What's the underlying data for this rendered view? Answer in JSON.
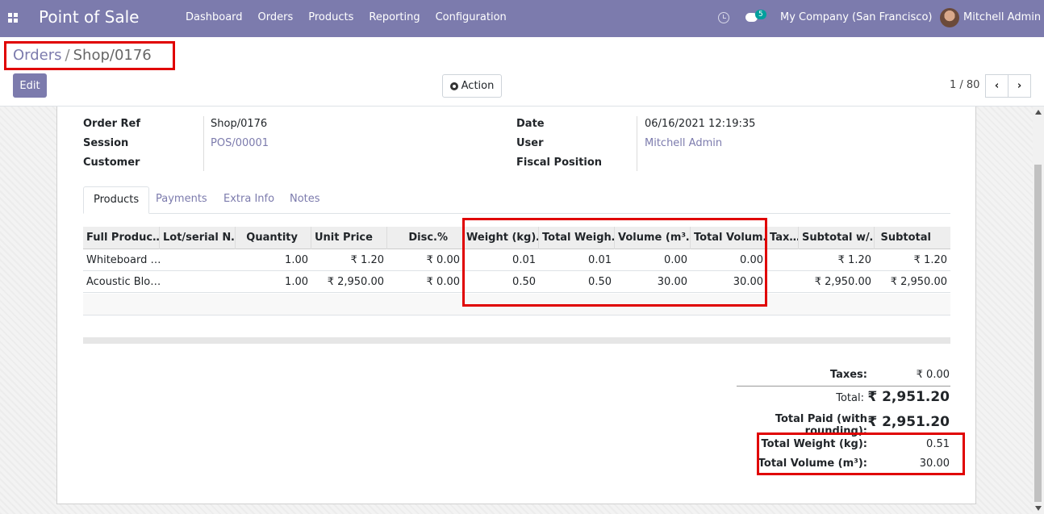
{
  "navbar": {
    "app_title": "Point of Sale",
    "menu": [
      "Dashboard",
      "Orders",
      "Products",
      "Reporting",
      "Configuration"
    ],
    "chat_count": "5",
    "company": "My Company (San Francisco)",
    "user": "Mitchell Admin",
    "accent": "#7c7bad"
  },
  "breadcrumb": {
    "parent": "Orders",
    "separator": "/",
    "current": "Shop/0176"
  },
  "toolbar": {
    "edit_label": "Edit",
    "action_label": "Action"
  },
  "pager": {
    "value": "1 / 80",
    "prev": "‹",
    "next": "›"
  },
  "form": {
    "order_ref_label": "Order Ref",
    "order_ref": "Shop/0176",
    "session_label": "Session",
    "session": "POS/00001",
    "customer_label": "Customer",
    "customer": "",
    "date_label": "Date",
    "date": "06/16/2021 12:19:35",
    "user_label": "User",
    "user": "Mitchell Admin",
    "fiscal_label": "Fiscal Position",
    "fiscal": ""
  },
  "tabs": [
    "Products",
    "Payments",
    "Extra Info",
    "Notes"
  ],
  "table": {
    "headers": [
      "Full Produc…",
      "Lot/serial N…",
      "Quantity",
      "Unit Price",
      "Disc.%",
      "Weight (kg)…",
      "Total Weigh…",
      "Volume (m³…",
      "Total Volum…",
      "Tax…",
      "Subtotal w/…",
      "Subtotal"
    ],
    "rows": [
      [
        "Whiteboard …",
        "",
        "1.00",
        "₹ 1.20",
        "₹ 0.00",
        "0.01",
        "0.01",
        "0.00",
        "0.00",
        "",
        "₹ 1.20",
        "₹ 1.20"
      ],
      [
        "Acoustic Blo…",
        "",
        "1.00",
        "₹ 2,950.00",
        "₹ 0.00",
        "0.50",
        "0.50",
        "30.00",
        "30.00",
        "",
        "₹ 2,950.00",
        "₹ 2,950.00"
      ]
    ]
  },
  "totals": {
    "taxes_label": "Taxes:",
    "taxes": "₹ 0.00",
    "total_label": "Total:",
    "total": "₹ 2,951.20",
    "paid_label": "Total Paid (with rounding):",
    "paid": "₹ 2,951.20",
    "weight_label": "Total Weight (kg):",
    "weight": "0.51",
    "volume_label": "Total Volume (m³):",
    "volume": "30.00"
  },
  "highlight_color": "#e00000"
}
